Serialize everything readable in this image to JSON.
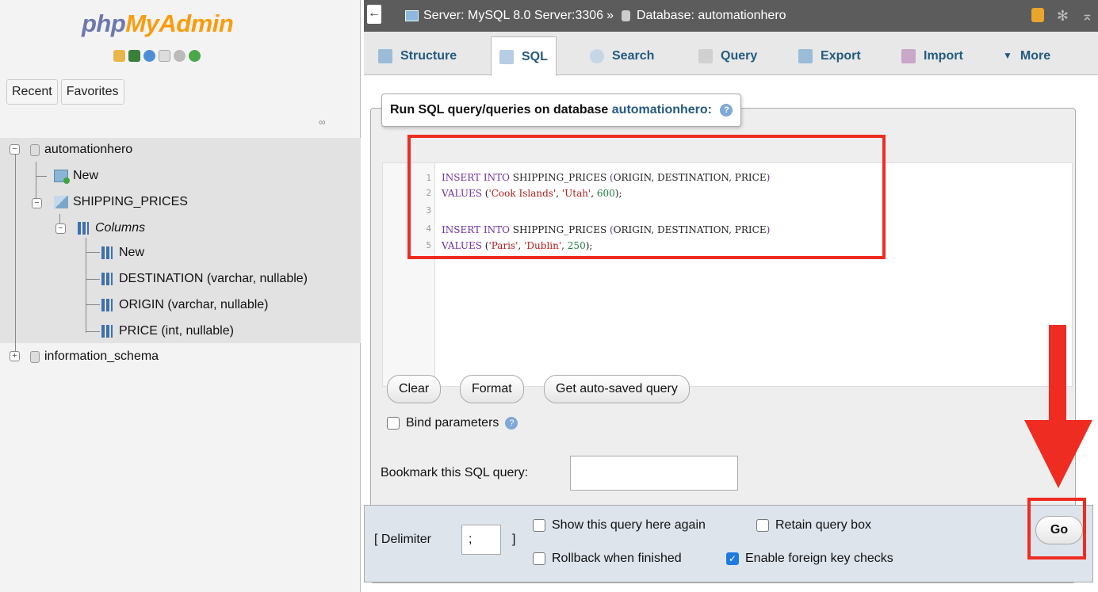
{
  "logo": {
    "part1": "php",
    "part2": "MyAdmin"
  },
  "nav_tabs": [
    "Recent",
    "Favorites"
  ],
  "tree": {
    "db1": "automationhero",
    "db1_new": "New",
    "table": "SHIPPING_PRICES",
    "columns_label": "Columns",
    "col_new": "New",
    "col1": "DESTINATION (varchar, nullable)",
    "col2": "ORIGIN (varchar, nullable)",
    "col3": "PRICE (int, nullable)",
    "db2": "information_schema"
  },
  "topbar": {
    "server": "Server: MySQL 8.0 Server:3306",
    "sep": "»",
    "database": "Database: automationhero"
  },
  "tabs": [
    "Structure",
    "SQL",
    "Search",
    "Query",
    "Export",
    "Import",
    "More"
  ],
  "query_panel": {
    "legend_prefix": "Run SQL query/queries on database",
    "legend_db": "automationhero:",
    "help": "?",
    "lines": [
      "1",
      "2",
      "3",
      "4",
      "5"
    ]
  },
  "buttons": {
    "clear": "Clear",
    "format": "Format",
    "autosaved": "Get auto-saved query",
    "go": "Go"
  },
  "bind_parameters": "Bind parameters",
  "bookmark_label": "Bookmark this SQL query:",
  "bottom": {
    "delimiter_open": "[ Delimiter",
    "delimiter_value": ";",
    "delimiter_close": "]",
    "show_query": "Show this query here again",
    "retain": "Retain query box",
    "rollback": "Rollback when finished",
    "fk_checks": "Enable foreign key checks"
  },
  "colors": {
    "accent": "#235a81",
    "highlight": "#ee2c22",
    "logo_blue": "#6c78af",
    "logo_orange": "#f89c0e"
  }
}
